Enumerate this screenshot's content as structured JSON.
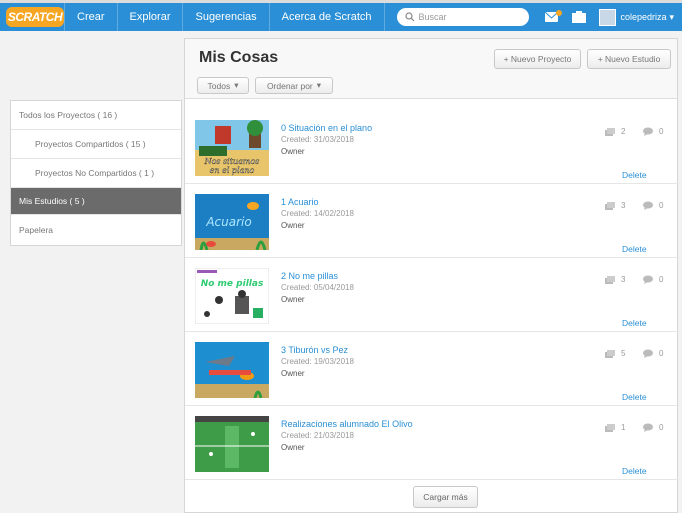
{
  "navbar": {
    "logo": "SCRATCH",
    "items": [
      "Crear",
      "Explorar",
      "Sugerencias",
      "Acerca de Scratch"
    ],
    "search_placeholder": "Buscar",
    "username": "colepedriza"
  },
  "sidebar": {
    "items": [
      {
        "label": "Todos los Proyectos ( 16 )",
        "active": false
      },
      {
        "label": "Proyectos Compartidos ( 15 )",
        "active": false
      },
      {
        "label": "Proyectos No Compartidos ( 1 )",
        "active": false
      },
      {
        "label": "Mis Estudios ( 5 )",
        "active": true
      },
      {
        "label": "Papelera",
        "active": false
      }
    ]
  },
  "main": {
    "title": "Mis Cosas",
    "new_project": "+ Nuevo Proyecto",
    "new_studio": "+ Nuevo Estudio",
    "filter": "Todos",
    "sort": "Ordenar por",
    "load_more": "Cargar más",
    "delete_label": "Delete",
    "studios": [
      {
        "title": "0 Situación en el plano",
        "created": "Created: 31/03/2018",
        "role": "Owner",
        "projects": "2",
        "comments": "0",
        "thumb_text": [
          "Nos situamos",
          "en el plano"
        ]
      },
      {
        "title": "1 Acuario",
        "created": "Created: 14/02/2018",
        "role": "Owner",
        "projects": "3",
        "comments": "0",
        "thumb_text": [
          "Acuario"
        ]
      },
      {
        "title": "2 No me pillas",
        "created": "Created: 05/04/2018",
        "role": "Owner",
        "projects": "3",
        "comments": "0",
        "thumb_text": [
          "No me pillas"
        ]
      },
      {
        "title": "3 Tiburón vs Pez",
        "created": "Created: 19/03/2018",
        "role": "Owner",
        "projects": "5",
        "comments": "0",
        "thumb_text": []
      },
      {
        "title": "Realizaciones alumnado El Olivo",
        "created": "Created: 21/03/2018",
        "role": "Owner",
        "projects": "1",
        "comments": "0",
        "thumb_text": []
      }
    ]
  },
  "colors": {
    "nav": "#2a8fd6",
    "link": "#2a8fd6",
    "active": "#6b6b6b"
  }
}
